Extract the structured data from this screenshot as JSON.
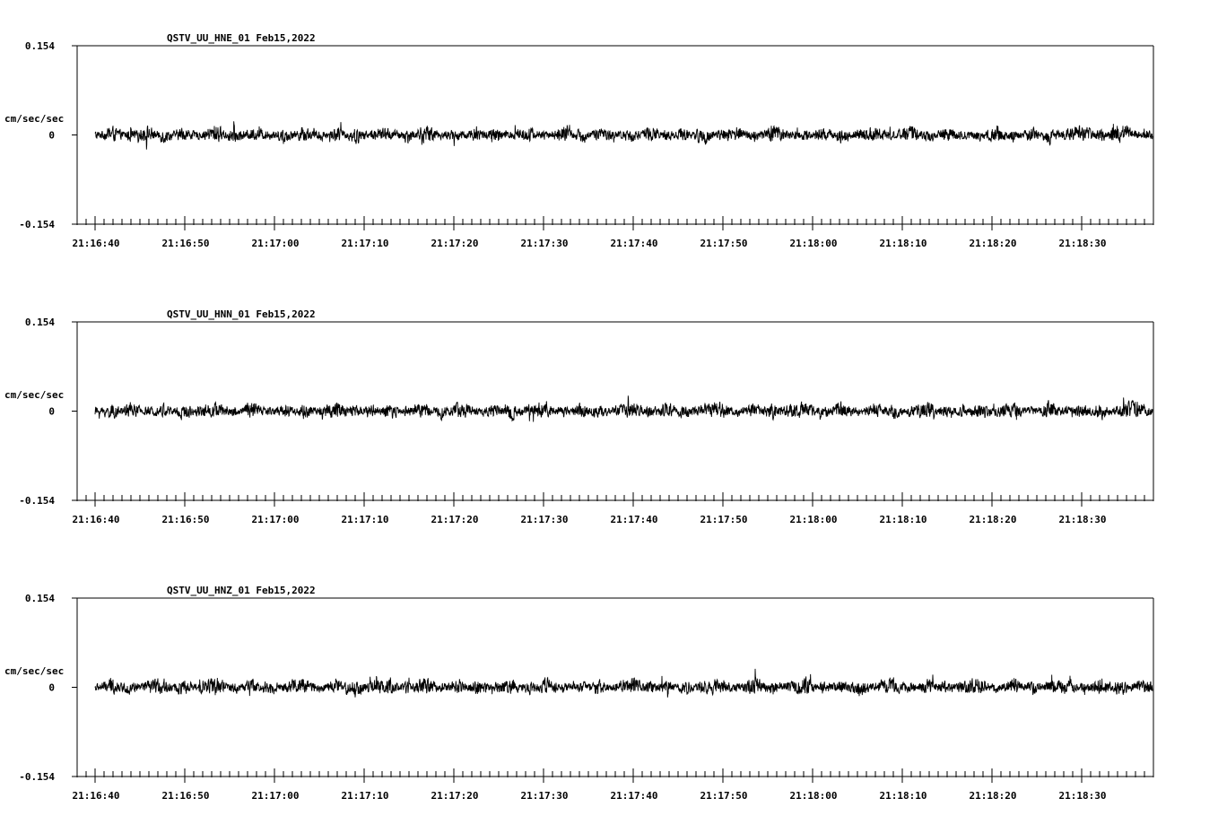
{
  "chart_data": [
    {
      "type": "line",
      "title": "QSTV_UU_HNE_01   Feb15,2022",
      "ylabel": "cm/sec/sec",
      "ylim": [
        -0.154,
        0.154
      ],
      "ytick_labels": [
        "0.154",
        "0",
        "-0.154"
      ],
      "ytick_values": [
        0.154,
        0,
        -0.154
      ],
      "x_start": "21:16:40",
      "x_end": "21:18:38",
      "xtick_labels": [
        "21:16:40",
        "21:16:50",
        "21:17:00",
        "21:17:10",
        "21:17:20",
        "21:17:30",
        "21:17:40",
        "21:17:50",
        "21:18:00",
        "21:18:10",
        "21:18:20",
        "21:18:30"
      ],
      "xtick_seconds": [
        0,
        10,
        20,
        30,
        40,
        50,
        60,
        70,
        80,
        90,
        100,
        110
      ],
      "duration_seconds": 118,
      "series": [
        {
          "values": [
            -0.004,
            0.01,
            -0.006,
            0.012,
            -0.01,
            0.008,
            -0.002,
            0.014,
            -0.012,
            0.006,
            0.003,
            -0.008,
            0.011,
            -0.005,
            0.009,
            -0.011,
            0.004,
            0.007,
            -0.009,
            0.013,
            0.0,
            -0.006,
            0.01,
            -0.013,
            0.005,
            0.008,
            -0.004,
            0.012,
            -0.01,
            0.006,
            0.002,
            -0.007,
            0.011,
            -0.006,
            0.009,
            -0.012,
            0.004,
            0.01,
            -0.008,
            0.014,
            0.001,
            -0.005,
            0.01,
            -0.011,
            0.006,
            0.008,
            -0.003,
            0.012,
            -0.009,
            0.007,
            0.003,
            -0.006,
            0.013,
            -0.008,
            0.01,
            -0.01,
            0.005,
            0.011,
            -0.007,
            0.015,
            0.002,
            -0.004
          ]
        }
      ]
    },
    {
      "type": "line",
      "title": "QSTV_UU_HNN_01   Feb15,2022",
      "ylabel": "cm/sec/sec",
      "ylim": [
        -0.154,
        0.154
      ],
      "ytick_labels": [
        "0.154",
        "0",
        "-0.154"
      ],
      "ytick_values": [
        0.154,
        0,
        -0.154
      ],
      "x_start": "21:16:40",
      "x_end": "21:18:38",
      "xtick_labels": [
        "21:16:40",
        "21:16:50",
        "21:17:00",
        "21:17:10",
        "21:17:20",
        "21:17:30",
        "21:17:40",
        "21:17:50",
        "21:18:00",
        "21:18:10",
        "21:18:20",
        "21:18:30"
      ],
      "xtick_seconds": [
        0,
        10,
        20,
        30,
        40,
        50,
        60,
        70,
        80,
        90,
        100,
        110
      ],
      "duration_seconds": 118,
      "series": [
        {
          "values": [
            0.003,
            -0.009,
            0.011,
            -0.004,
            0.008,
            -0.012,
            0.006,
            0.01,
            -0.007,
            0.013,
            -0.002,
            0.009,
            -0.01,
            0.005,
            0.012,
            -0.006,
            0.008,
            -0.011,
            0.004,
            0.01,
            -0.008,
            0.014,
            -0.003,
            0.007,
            -0.012,
            0.006,
            0.011,
            -0.005,
            0.009,
            -0.01,
            0.003,
            0.012,
            -0.007,
            0.01,
            -0.009,
            0.005,
            0.013,
            -0.004,
            0.008,
            -0.011,
            0.006,
            0.01,
            -0.006,
            0.012,
            -0.002,
            0.009,
            -0.01,
            0.004,
            0.011,
            -0.008,
            0.007,
            -0.012,
            0.005,
            0.01,
            -0.005,
            0.013,
            -0.003,
            0.008,
            -0.009,
            0.006,
            0.014,
            -0.001
          ]
        }
      ]
    },
    {
      "type": "line",
      "title": "QSTV_UU_HNZ_01   Feb15,2022",
      "ylabel": "cm/sec/sec",
      "ylim": [
        -0.154,
        0.154
      ],
      "ytick_labels": [
        "0.154",
        "0",
        "-0.154"
      ],
      "ytick_values": [
        0.154,
        0,
        -0.154
      ],
      "x_start": "21:16:40",
      "x_end": "21:18:38",
      "xtick_labels": [
        "21:16:40",
        "21:16:50",
        "21:17:00",
        "21:17:10",
        "21:17:20",
        "21:17:30",
        "21:17:40",
        "21:17:50",
        "21:18:00",
        "21:18:10",
        "21:18:20",
        "21:18:30"
      ],
      "xtick_seconds": [
        0,
        10,
        20,
        30,
        40,
        50,
        60,
        70,
        80,
        90,
        100,
        110
      ],
      "duration_seconds": 118,
      "series": [
        {
          "values": [
            -0.002,
            0.011,
            -0.008,
            0.006,
            0.01,
            -0.012,
            0.004,
            0.013,
            -0.006,
            0.009,
            -0.01,
            0.005,
            0.012,
            -0.004,
            0.008,
            -0.013,
            0.006,
            0.011,
            -0.007,
            0.014,
            -0.003,
            0.009,
            -0.011,
            0.005,
            0.01,
            -0.008,
            0.012,
            -0.005,
            0.007,
            -0.012,
            0.004,
            0.013,
            -0.006,
            0.01,
            -0.009,
            0.006,
            0.011,
            -0.004,
            0.015,
            -0.01,
            0.005,
            0.012,
            -0.007,
            0.009,
            -0.011,
            0.004,
            0.013,
            -0.006,
            0.01,
            -0.008,
            0.006,
            0.011,
            -0.005,
            0.012,
            -0.009,
            0.007,
            0.01,
            -0.004,
            0.013,
            -0.01,
            0.005,
            0.008
          ]
        }
      ]
    }
  ]
}
